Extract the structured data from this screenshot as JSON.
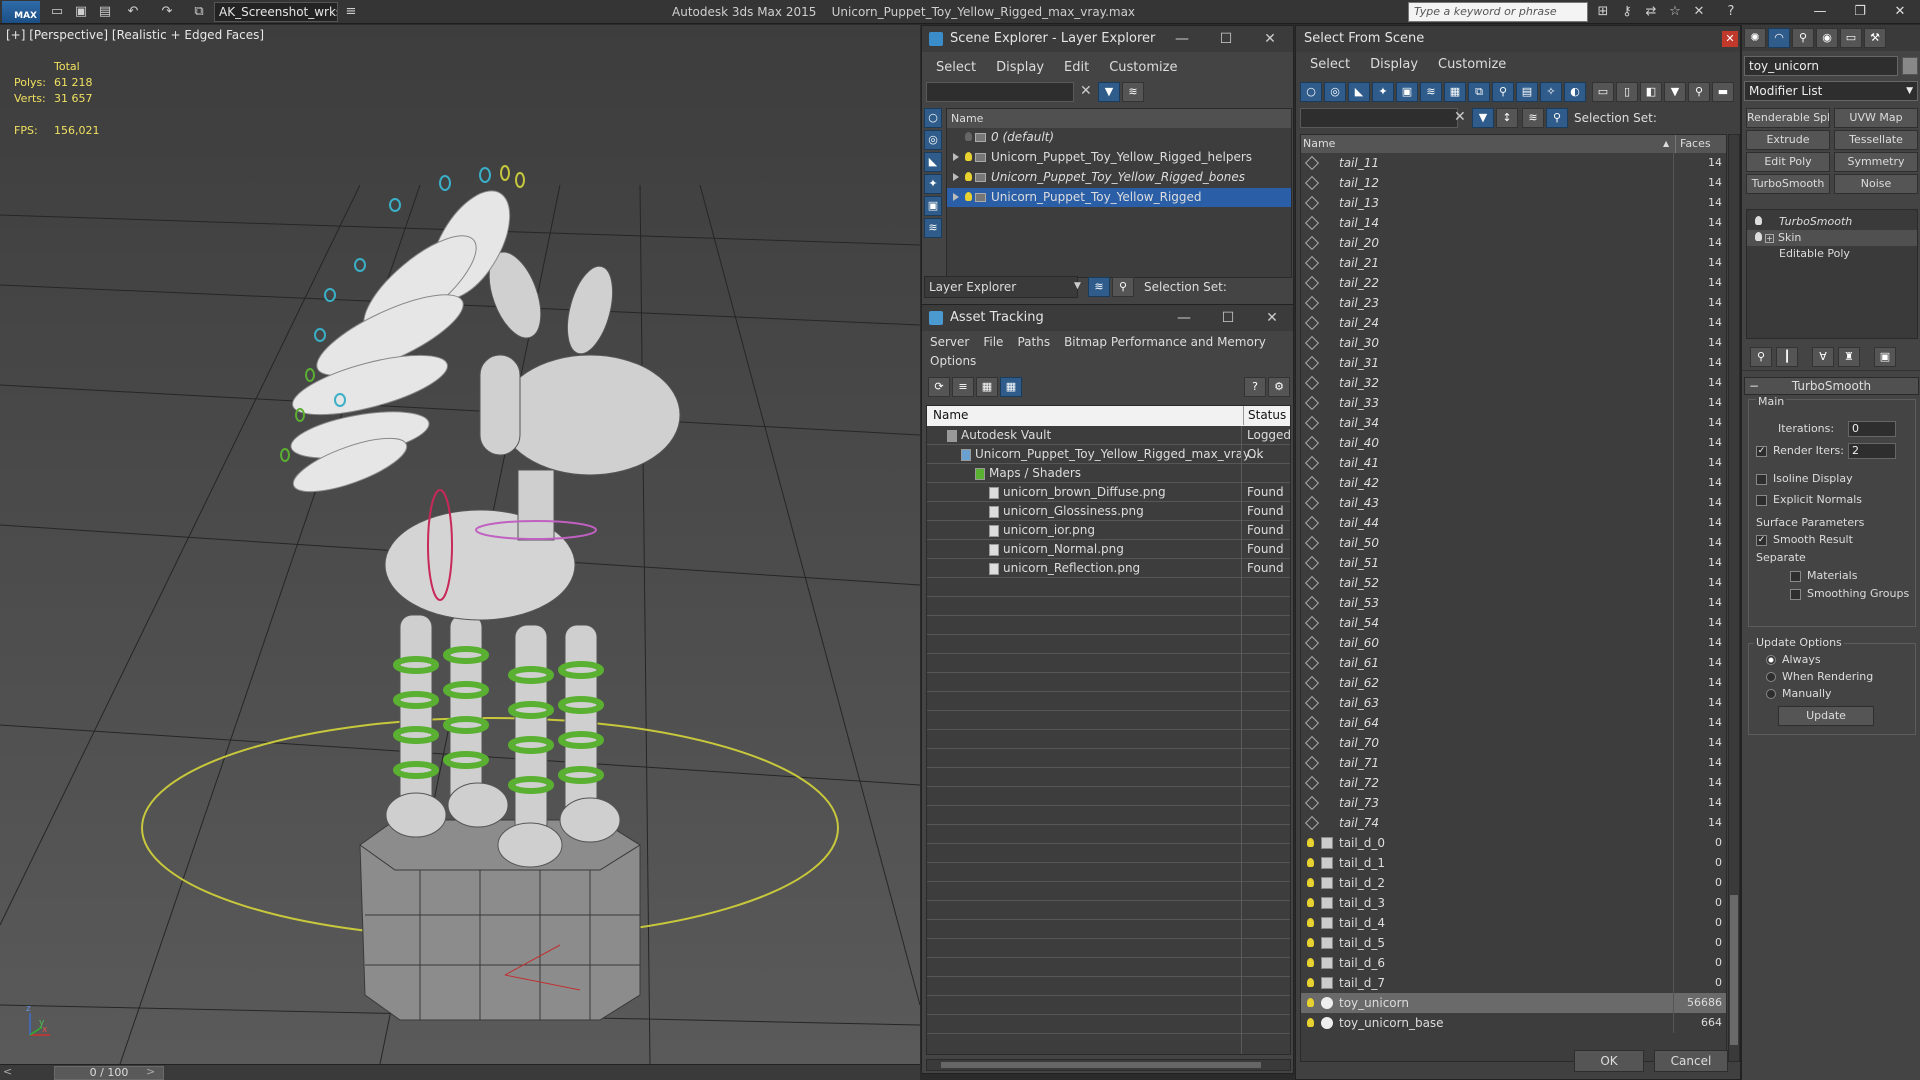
{
  "app": {
    "logo_text": "MAX",
    "workspace": "AK_Screenshot_wrksp",
    "title_app": "Autodesk 3ds Max  2015",
    "title_file": "Unicorn_Puppet_Toy_Yellow_Rigged_max_vray.max",
    "search_placeholder": "Type a keyword or phrase"
  },
  "viewport": {
    "label": "[+] [Perspective] [Realistic + Edged Faces]",
    "stats": {
      "total_label": "Total",
      "polys_label": "Polys:",
      "polys_value": "61 218",
      "verts_label": "Verts:",
      "verts_value": "31 657",
      "fps_label": "FPS:",
      "fps_value": "156,021"
    },
    "axis_x": "x",
    "axis_y": "y",
    "axis_z": "z"
  },
  "timeline": {
    "frame": "0 / 100"
  },
  "scene_explorer": {
    "title": "Scene Explorer - Layer Explorer",
    "menu": [
      "Select",
      "Display",
      "Edit",
      "Customize"
    ],
    "col_name": "Name",
    "layers": [
      {
        "name": "0 (default)",
        "italic": true,
        "selected": false,
        "expand": false
      },
      {
        "name": "Unicorn_Puppet_Toy_Yellow_Rigged_helpers",
        "italic": false,
        "selected": false,
        "expand": true
      },
      {
        "name": "Unicorn_Puppet_Toy_Yellow_Rigged_bones",
        "italic": true,
        "selected": false,
        "expand": true
      },
      {
        "name": "Unicorn_Puppet_Toy_Yellow_Rigged",
        "italic": false,
        "selected": true,
        "expand": true
      }
    ],
    "footer_label": "Layer Explorer",
    "selection_set_label": "Selection Set:"
  },
  "asset_tracking": {
    "title": "Asset Tracking",
    "menu": [
      "Server",
      "File",
      "Paths",
      "Bitmap Performance and Memory"
    ],
    "menu2": "Options",
    "col_name": "Name",
    "col_status": "Status",
    "rows": [
      {
        "name": "Autodesk Vault",
        "status": "Logged",
        "indent": 1
      },
      {
        "name": "Unicorn_Puppet_Toy_Yellow_Rigged_max_vray....",
        "status": "Ok",
        "indent": 2
      },
      {
        "name": "Maps / Shaders",
        "status": "",
        "indent": 3
      },
      {
        "name": "unicorn_brown_Diffuse.png",
        "status": "Found",
        "indent": 4
      },
      {
        "name": "unicorn_Glossiness.png",
        "status": "Found",
        "indent": 4
      },
      {
        "name": "unicorn_ior.png",
        "status": "Found",
        "indent": 4
      },
      {
        "name": "unicorn_Normal.png",
        "status": "Found",
        "indent": 4
      },
      {
        "name": "unicorn_Reflection.png",
        "status": "Found",
        "indent": 4
      }
    ]
  },
  "select_from_scene": {
    "title": "Select From Scene",
    "menu": [
      "Select",
      "Display",
      "Customize"
    ],
    "selection_set_label": "Selection Set:",
    "col_name": "Name",
    "col_faces": "Faces",
    "rows": [
      {
        "name": "tail_11",
        "faces": "14",
        "kind": "bone"
      },
      {
        "name": "tail_12",
        "faces": "14",
        "kind": "bone"
      },
      {
        "name": "tail_13",
        "faces": "14",
        "kind": "bone"
      },
      {
        "name": "tail_14",
        "faces": "14",
        "kind": "bone"
      },
      {
        "name": "tail_20",
        "faces": "14",
        "kind": "bone"
      },
      {
        "name": "tail_21",
        "faces": "14",
        "kind": "bone"
      },
      {
        "name": "tail_22",
        "faces": "14",
        "kind": "bone"
      },
      {
        "name": "tail_23",
        "faces": "14",
        "kind": "bone"
      },
      {
        "name": "tail_24",
        "faces": "14",
        "kind": "bone"
      },
      {
        "name": "tail_30",
        "faces": "14",
        "kind": "bone"
      },
      {
        "name": "tail_31",
        "faces": "14",
        "kind": "bone"
      },
      {
        "name": "tail_32",
        "faces": "14",
        "kind": "bone"
      },
      {
        "name": "tail_33",
        "faces": "14",
        "kind": "bone"
      },
      {
        "name": "tail_34",
        "faces": "14",
        "kind": "bone"
      },
      {
        "name": "tail_40",
        "faces": "14",
        "kind": "bone"
      },
      {
        "name": "tail_41",
        "faces": "14",
        "kind": "bone"
      },
      {
        "name": "tail_42",
        "faces": "14",
        "kind": "bone"
      },
      {
        "name": "tail_43",
        "faces": "14",
        "kind": "bone"
      },
      {
        "name": "tail_44",
        "faces": "14",
        "kind": "bone"
      },
      {
        "name": "tail_50",
        "faces": "14",
        "kind": "bone"
      },
      {
        "name": "tail_51",
        "faces": "14",
        "kind": "bone"
      },
      {
        "name": "tail_52",
        "faces": "14",
        "kind": "bone"
      },
      {
        "name": "tail_53",
        "faces": "14",
        "kind": "bone"
      },
      {
        "name": "tail_54",
        "faces": "14",
        "kind": "bone"
      },
      {
        "name": "tail_60",
        "faces": "14",
        "kind": "bone"
      },
      {
        "name": "tail_61",
        "faces": "14",
        "kind": "bone"
      },
      {
        "name": "tail_62",
        "faces": "14",
        "kind": "bone"
      },
      {
        "name": "tail_63",
        "faces": "14",
        "kind": "bone"
      },
      {
        "name": "tail_64",
        "faces": "14",
        "kind": "bone"
      },
      {
        "name": "tail_70",
        "faces": "14",
        "kind": "bone"
      },
      {
        "name": "tail_71",
        "faces": "14",
        "kind": "bone"
      },
      {
        "name": "tail_72",
        "faces": "14",
        "kind": "bone"
      },
      {
        "name": "tail_73",
        "faces": "14",
        "kind": "bone"
      },
      {
        "name": "tail_74",
        "faces": "14",
        "kind": "bone"
      },
      {
        "name": "tail_d_0",
        "faces": "0",
        "kind": "helper"
      },
      {
        "name": "tail_d_1",
        "faces": "0",
        "kind": "helper"
      },
      {
        "name": "tail_d_2",
        "faces": "0",
        "kind": "helper"
      },
      {
        "name": "tail_d_3",
        "faces": "0",
        "kind": "helper"
      },
      {
        "name": "tail_d_4",
        "faces": "0",
        "kind": "helper"
      },
      {
        "name": "tail_d_5",
        "faces": "0",
        "kind": "helper"
      },
      {
        "name": "tail_d_6",
        "faces": "0",
        "kind": "helper"
      },
      {
        "name": "tail_d_7",
        "faces": "0",
        "kind": "helper"
      },
      {
        "name": "toy_unicorn",
        "faces": "56686",
        "kind": "mesh",
        "selected": true
      },
      {
        "name": "toy_unicorn_base",
        "faces": "664",
        "kind": "mesh"
      }
    ],
    "ok_label": "OK",
    "cancel_label": "Cancel"
  },
  "command_panel": {
    "object_name": "toy_unicorn",
    "modifier_list": "Modifier List",
    "buttons": [
      "Renderable Spline",
      "UVW Map",
      "Extrude",
      "Tessellate",
      "Edit Poly",
      "Symmetry",
      "TurboSmooth",
      "Noise"
    ],
    "stack": [
      "TurboSmooth",
      "Skin",
      "Editable Poly"
    ],
    "rollout_title": "TurboSmooth",
    "main_label": "Main",
    "iterations_label": "Iterations:",
    "iterations_value": "0",
    "render_iters_label": "Render Iters:",
    "render_iters_value": "2",
    "isoline_label": "Isoline Display",
    "explicit_normals_label": "Explicit Normals",
    "surface_label": "Surface Parameters",
    "smooth_result_label": "Smooth Result",
    "separate_label": "Separate",
    "materials_label": "Materials",
    "smoothing_groups_label": "Smoothing Groups",
    "update_options_label": "Update Options",
    "always_label": "Always",
    "when_rendering_label": "When Rendering",
    "manually_label": "Manually",
    "update_button": "Update"
  },
  "colors": {
    "selection_blue": "#2a5fa8",
    "bone_green": "#5ab031",
    "helper_yellow": "#c8c83c",
    "viewport_bg": "#4a4a4a"
  }
}
